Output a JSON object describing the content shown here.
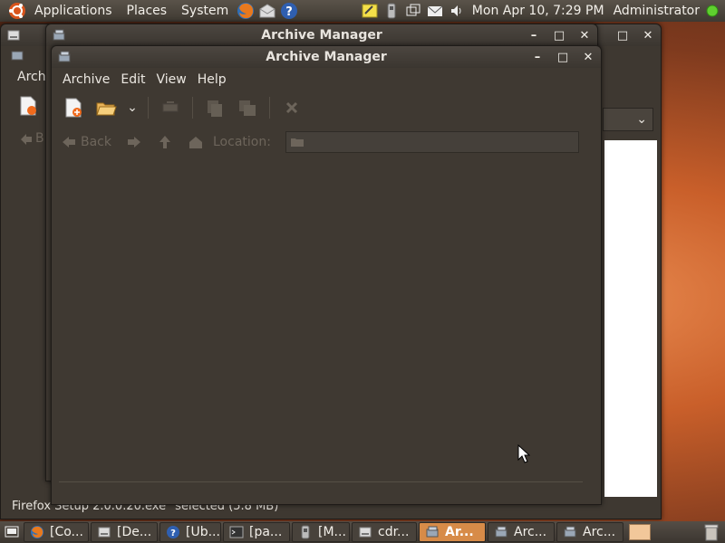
{
  "top_panel": {
    "menus": [
      "Applications",
      "Places",
      "System"
    ],
    "clock": "Mon Apr 10,  7:29 PM",
    "user": "Administrator",
    "launchers": [
      "firefox-icon",
      "mail-icon",
      "help-icon"
    ],
    "tray_icons": [
      "notes-icon",
      "network-icon",
      "windows-icon",
      "mail-icon",
      "volume-icon"
    ]
  },
  "back_window": {
    "menu_fragment": "Archi",
    "nav_fragment": "B",
    "status": "Firefox Setup 2.0.0.20.exe\" selected (5.8 MB)"
  },
  "mid_window": {
    "title": "Archive Manager"
  },
  "front_window": {
    "title": "Archive Manager",
    "menus": [
      "Archive",
      "Edit",
      "View",
      "Help"
    ],
    "nav": {
      "back_label": "Back",
      "location_label": "Location:"
    },
    "location_value": ""
  },
  "taskbar": {
    "tasks": [
      {
        "label": "[Co...",
        "icon": "firefox-icon"
      },
      {
        "label": "[De...",
        "icon": "drive-icon"
      },
      {
        "label": "[Ub...",
        "icon": "help-icon"
      },
      {
        "label": "[pa...",
        "icon": "terminal-icon"
      },
      {
        "label": "[M...",
        "icon": "network-icon"
      },
      {
        "label": "cdr...",
        "icon": "drive-icon"
      },
      {
        "label": "Ar...",
        "icon": "archive-icon",
        "active": true
      },
      {
        "label": "Arc...",
        "icon": "archive-icon"
      },
      {
        "label": "Arc...",
        "icon": "archive-icon"
      }
    ]
  },
  "colors": {
    "accent": "#d78b48",
    "window_bg": "#3e3831",
    "panel_bg": "#4a443d"
  }
}
